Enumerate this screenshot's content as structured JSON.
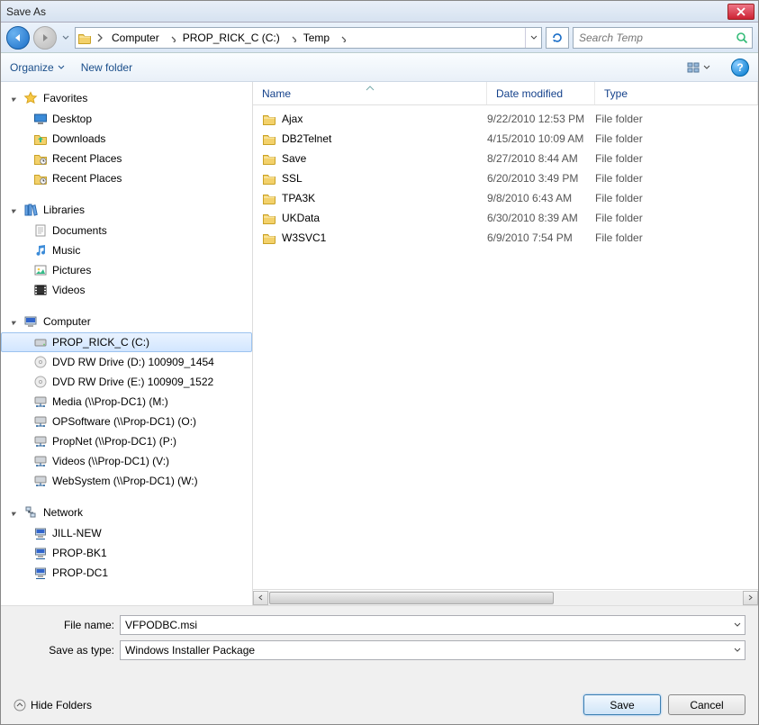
{
  "title": "Save As",
  "breadcrumbs": [
    "Computer",
    "PROP_RICK_C (C:)",
    "Temp"
  ],
  "search_placeholder": "Search Temp",
  "toolbar": {
    "organize": "Organize",
    "newfolder": "New folder"
  },
  "sidebar": {
    "favorites": {
      "label": "Favorites",
      "items": [
        "Desktop",
        "Downloads",
        "Recent Places",
        "Recent Places"
      ]
    },
    "libraries": {
      "label": "Libraries",
      "items": [
        "Documents",
        "Music",
        "Pictures",
        "Videos"
      ]
    },
    "computer": {
      "label": "Computer",
      "items": [
        "PROP_RICK_C (C:)",
        "DVD RW Drive (D:) 100909_1454",
        "DVD RW Drive (E:) 100909_1522",
        "Media (\\\\Prop-DC1) (M:)",
        "OPSoftware (\\\\Prop-DC1) (O:)",
        "PropNet (\\\\Prop-DC1) (P:)",
        "Videos (\\\\Prop-DC1) (V:)",
        "WebSystem (\\\\Prop-DC1) (W:)"
      ],
      "selected_index": 0
    },
    "network": {
      "label": "Network",
      "items": [
        "JILL-NEW",
        "PROP-BK1",
        "PROP-DC1"
      ]
    }
  },
  "columns": {
    "name": "Name",
    "date": "Date modified",
    "type": "Type"
  },
  "files": [
    {
      "name": "Ajax",
      "date": "9/22/2010 12:53 PM",
      "type": "File folder"
    },
    {
      "name": "DB2Telnet",
      "date": "4/15/2010 10:09 AM",
      "type": "File folder"
    },
    {
      "name": "Save",
      "date": "8/27/2010 8:44 AM",
      "type": "File folder"
    },
    {
      "name": "SSL",
      "date": "6/20/2010 3:49 PM",
      "type": "File folder"
    },
    {
      "name": "TPA3K",
      "date": "9/8/2010 6:43 AM",
      "type": "File folder"
    },
    {
      "name": "UKData",
      "date": "6/30/2010 8:39 AM",
      "type": "File folder"
    },
    {
      "name": "W3SVC1",
      "date": "6/9/2010 7:54 PM",
      "type": "File folder"
    }
  ],
  "form": {
    "filename_label": "File name:",
    "filename_value": "VFPODBC.msi",
    "type_label": "Save as type:",
    "type_value": "Windows Installer Package"
  },
  "footer": {
    "hide": "Hide Folders",
    "save": "Save",
    "cancel": "Cancel"
  }
}
